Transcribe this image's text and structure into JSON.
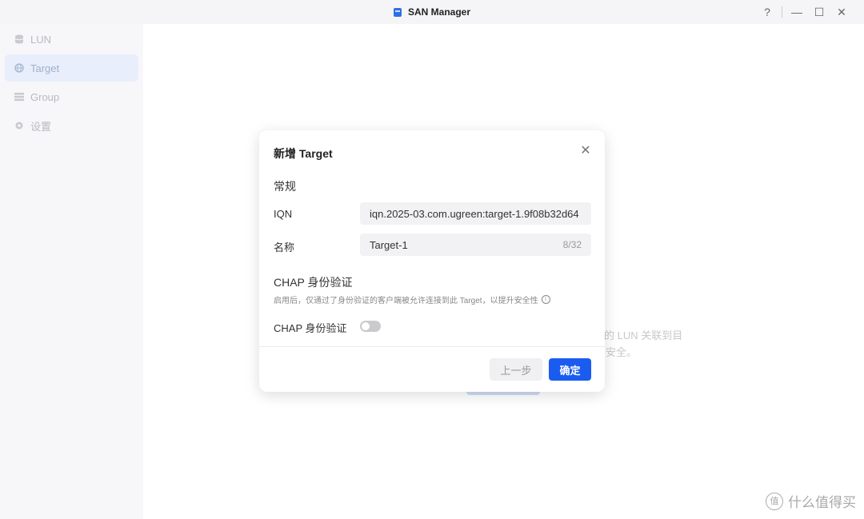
{
  "window": {
    "title": "SAN Manager",
    "help": "?",
    "minimize": "—",
    "maximize": "☐",
    "close": "✕"
  },
  "sidebar": {
    "items": [
      {
        "label": "LUN",
        "icon": "database-icon"
      },
      {
        "label": "Target",
        "icon": "globe-icon",
        "active": true
      },
      {
        "label": "Group",
        "icon": "list-icon"
      },
      {
        "label": "设置",
        "icon": "gear-icon"
      }
    ]
  },
  "background": {
    "line1": "的 LUN 关联到目",
    "line2": "安全。"
  },
  "dialog": {
    "title": "新增 Target",
    "close": "✕",
    "general_section": "常规",
    "iqn_label": "IQN",
    "iqn_value": "iqn.2025-03.com.ugreen:target-1.9f08b32d64",
    "name_label": "名称",
    "name_value": "Target-1",
    "name_count": "8/32",
    "chap_section": "CHAP 身份验证",
    "chap_hint": "启用后，仅通过了身份验证的客户端被允许连接到此 Target，以提升安全性",
    "chap_toggle_label": "CHAP 身份验证",
    "chap_enabled": false,
    "prev_button": "上一步",
    "ok_button": "确定"
  },
  "watermark": {
    "logo": "值",
    "text": "什么值得买"
  },
  "colors": {
    "accent": "#1a5cf0",
    "sidebar_active_bg": "#e8eefb"
  }
}
